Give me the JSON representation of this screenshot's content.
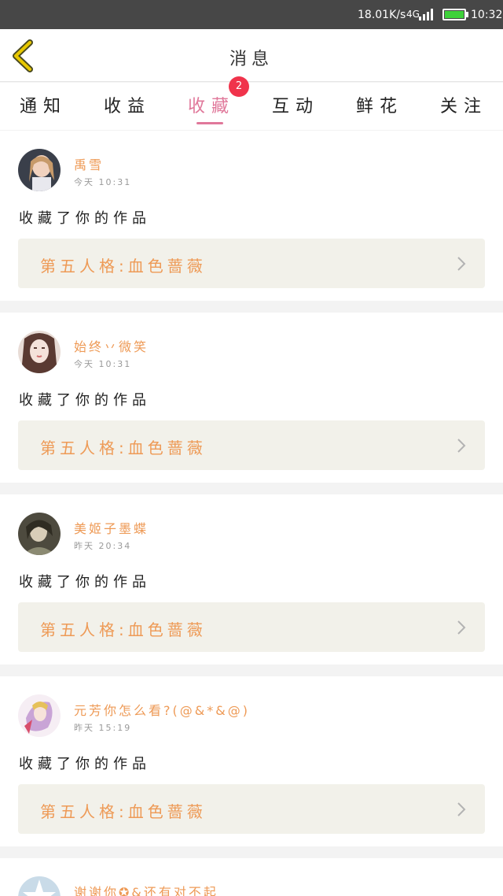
{
  "status_bar": {
    "network_speed": "18.01K/s",
    "network_type": "4G",
    "time": "10:32",
    "battery_color": "#3ed13a"
  },
  "header": {
    "title": "消息",
    "back_icon": "chevron-left-icon",
    "back_icon_color": "#e8c800"
  },
  "tabs": {
    "items": [
      {
        "label": "通知"
      },
      {
        "label": "收益"
      },
      {
        "label": "收藏"
      },
      {
        "label": "互动"
      },
      {
        "label": "鲜花"
      },
      {
        "label": "关注"
      }
    ],
    "active": "收藏",
    "badge": "2",
    "accent_color": "#e0789a"
  },
  "messages": [
    {
      "username": "禹雪",
      "time": "今天 10:31",
      "action": "收藏了你的作品",
      "work_title": "第五人格:血色蔷薇"
    },
    {
      "username": "始终丷微笑",
      "time": "今天 10:31",
      "action": "收藏了你的作品",
      "work_title": "第五人格:血色蔷薇"
    },
    {
      "username": "美姬子墨蝶",
      "time": "昨天 20:34",
      "action": "收藏了你的作品",
      "work_title": "第五人格:血色蔷薇"
    },
    {
      "username": "元芳你怎么看?(@&*&@)",
      "time": "昨天 15:19",
      "action": "收藏了你的作品",
      "work_title": "第五人格:血色蔷薇"
    },
    {
      "username": "谢谢你✪&还有对不起"
    }
  ],
  "colors": {
    "username": "#ee9a56",
    "work_card_bg": "#f2f1ea"
  }
}
